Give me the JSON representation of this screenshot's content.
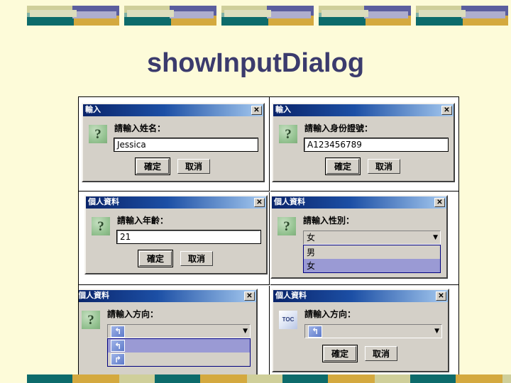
{
  "slide": {
    "title": "showInputDialog",
    "background_color": "#fdfbd9",
    "title_color": "#3b3b6d"
  },
  "decor": {
    "name": "banner-strip",
    "colors": {
      "teal_dark": "#0d6b6b",
      "teal_light": "#7fb0a5",
      "gold": "#d4a93f",
      "purple": "#5b5e9e",
      "khaki": "#cfcf9a",
      "lavender": "#aeaecd",
      "pale": "#dcddbd"
    },
    "unit_count_top": 5,
    "unit_count_bottom": 6
  },
  "common": {
    "ok_label": "確定",
    "cancel_label": "取消",
    "close_glyph": "✕",
    "question_icon_glyph": "?",
    "toc_icon_label": "TOC",
    "dropdown_arrow_glyph": "▼",
    "arrow_left_glyph": "↰",
    "arrow_right_glyph": "↱"
  },
  "dialogs": [
    {
      "id": "name-dialog",
      "title": "輸入",
      "icon": "question-icon",
      "prompt": "請輸入姓名：",
      "input_type": "text",
      "value": "Jessica",
      "buttons": [
        "確定",
        "取消"
      ]
    },
    {
      "id": "id-number-dialog",
      "title": "輸入",
      "icon": "question-icon",
      "prompt": "請輸入身份證號：",
      "input_type": "text",
      "value": "A123456789",
      "buttons": [
        "確定",
        "取消"
      ]
    },
    {
      "id": "age-dialog",
      "title": "個人資料",
      "icon": "question-icon",
      "prompt": "請輸入年齡：",
      "input_type": "text",
      "value": "21",
      "buttons": [
        "確定",
        "取消"
      ]
    },
    {
      "id": "gender-dialog",
      "title": "個人資料",
      "icon": "question-icon",
      "prompt": "請輸入性別：",
      "input_type": "combo-open",
      "value": "女",
      "options": [
        "男",
        "女"
      ],
      "selected_option": "女",
      "highlight_color": "#9a9ad4"
    },
    {
      "id": "direction-dialog-open",
      "title": "個人資料",
      "icon": "question-icon",
      "prompt": "請輸入方向：",
      "input_type": "combo-open-icons",
      "value": "",
      "options": [
        "arrow-left-icon",
        "arrow-right-icon"
      ],
      "selected_option": "arrow-left-icon"
    },
    {
      "id": "direction-dialog-toc",
      "title": "個人資料",
      "icon": "toc-icon",
      "prompt": "請輸入方向：",
      "input_type": "combo-icon",
      "value": "arrow-left-icon",
      "buttons": [
        "確定",
        "取消"
      ]
    }
  ]
}
